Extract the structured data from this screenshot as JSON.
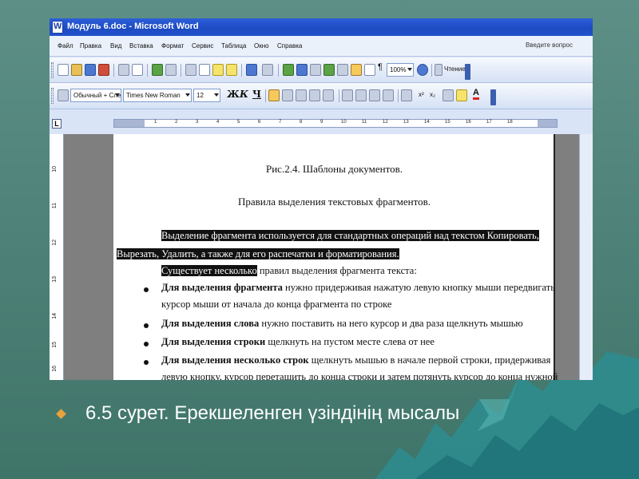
{
  "window": {
    "title": "Модуль 6.doc - Microsoft Word"
  },
  "menu": {
    "items": [
      "Файл",
      "Правка",
      "Вид",
      "Вставка",
      "Формат",
      "Сервис",
      "Таблица",
      "Окно",
      "Справка"
    ],
    "ask_placeholder": "Введите вопрос"
  },
  "toolbar": {
    "zoom": "100%",
    "reading_label": "Чтение",
    "style": "Обычный + Сле",
    "font": "Times New Roman",
    "size": "12",
    "bold": "Ж",
    "italic": "К",
    "underline": "Ч"
  },
  "ruler": {
    "h_ticks": [
      "1",
      "2",
      "3",
      "4",
      "5",
      "6",
      "7",
      "8",
      "9",
      "10",
      "11",
      "12",
      "13",
      "14",
      "15",
      "16",
      "17",
      "18"
    ],
    "v_ticks": [
      "10",
      "11",
      "12",
      "13",
      "14",
      "15",
      "16"
    ],
    "corner": "L"
  },
  "document": {
    "figure_caption": "Рис.2.4. Шаблоны документов.",
    "heading": "Правила выделения текстовых фрагментов.",
    "para1_line1": "Выделение фрагмента используется для стандартных операций над текстом Копировать,",
    "para1_line2": "Вырезать, Удалить, а также для его распечатки и форматирования.",
    "para2_highlight": "Существует несколько",
    "para2_rest": " правил выделения фрагмента текста:",
    "bullets": [
      {
        "bold": "Для выделения фрагмента",
        "text": " нужно придерживая нажатую левую кнопку мыши передвигать",
        "cont": "курсор мыши от начала до конца фрагмента по строке"
      },
      {
        "bold": "Для выделения слова",
        "text": " нужно поставить на него курсор и два раза щелкнуть мышью",
        "cont": ""
      },
      {
        "bold": "Для выделения строки",
        "text": "  щелкнуть на пустом месте слева от нее",
        "cont": ""
      },
      {
        "bold": "Для выделения несколько строк",
        "text": " щелкнуть мышью в начале первой строки, придерживая",
        "cont": "левую кнопку, курсор перетащить до конца строки и затем потянуть курсор до конца нужной"
      }
    ]
  },
  "caption": "6.5 сурет. Ерекшеленген үзіндінің мысалы",
  "colors": {
    "slide_bg": "#4f8378",
    "mountains": "#2e8b8b",
    "bullet": "#e8a23a",
    "titlebar": "#2354cc",
    "highlight": "#111111"
  }
}
